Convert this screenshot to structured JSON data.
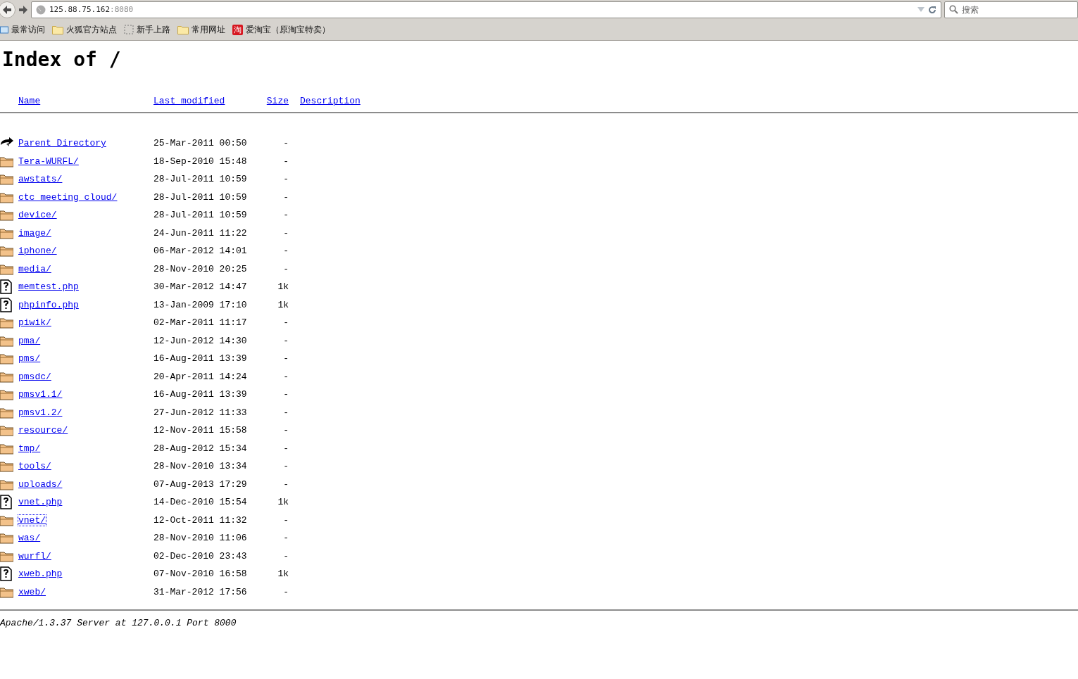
{
  "browser": {
    "url_host": "125.88.75.162",
    "url_port": ":8080",
    "search_placeholder": "搜索",
    "bookmarks": [
      {
        "kind": "frequent",
        "label": "最常访问"
      },
      {
        "kind": "folder",
        "label": "火狐官方站点"
      },
      {
        "kind": "blank",
        "label": "新手上路"
      },
      {
        "kind": "folder",
        "label": "常用网址"
      },
      {
        "kind": "badge",
        "badge_text": "淘",
        "label": "爱淘宝（原淘宝特卖）"
      }
    ]
  },
  "page": {
    "title": "Index of /",
    "columns": [
      "Name",
      "Last modified",
      "Size",
      "Description"
    ],
    "rows": [
      {
        "kind": "parent",
        "name": "Parent Directory",
        "modified": "25-Mar-2011 00:50",
        "size": "-",
        "focused": false
      },
      {
        "kind": "folder",
        "name": "Tera-WURFL/",
        "modified": "18-Sep-2010 15:48",
        "size": "-",
        "focused": false
      },
      {
        "kind": "folder",
        "name": "awstats/",
        "modified": "28-Jul-2011 10:59",
        "size": "-",
        "focused": false
      },
      {
        "kind": "folder",
        "name": "ctc_meeting_cloud/",
        "modified": "28-Jul-2011 10:59",
        "size": "-",
        "focused": false
      },
      {
        "kind": "folder",
        "name": "device/",
        "modified": "28-Jul-2011 10:59",
        "size": "-",
        "focused": false
      },
      {
        "kind": "folder",
        "name": "image/",
        "modified": "24-Jun-2011 11:22",
        "size": "-",
        "focused": false
      },
      {
        "kind": "folder",
        "name": "iphone/",
        "modified": "06-Mar-2012 14:01",
        "size": "-",
        "focused": false
      },
      {
        "kind": "folder",
        "name": "media/",
        "modified": "28-Nov-2010 20:25",
        "size": "-",
        "focused": false
      },
      {
        "kind": "file",
        "name": "memtest.php",
        "modified": "30-Mar-2012 14:47",
        "size": "1k",
        "focused": false
      },
      {
        "kind": "file",
        "name": "phpinfo.php",
        "modified": "13-Jan-2009 17:10",
        "size": "1k",
        "focused": false
      },
      {
        "kind": "folder",
        "name": "piwik/",
        "modified": "02-Mar-2011 11:17",
        "size": "-",
        "focused": false
      },
      {
        "kind": "folder",
        "name": "pma/",
        "modified": "12-Jun-2012 14:30",
        "size": "-",
        "focused": false
      },
      {
        "kind": "folder",
        "name": "pms/",
        "modified": "16-Aug-2011 13:39",
        "size": "-",
        "focused": false
      },
      {
        "kind": "folder",
        "name": "pmsdc/",
        "modified": "20-Apr-2011 14:24",
        "size": "-",
        "focused": false
      },
      {
        "kind": "folder",
        "name": "pmsv1.1/",
        "modified": "16-Aug-2011 13:39",
        "size": "-",
        "focused": false
      },
      {
        "kind": "folder",
        "name": "pmsv1.2/",
        "modified": "27-Jun-2012 11:33",
        "size": "-",
        "focused": false
      },
      {
        "kind": "folder",
        "name": "resource/",
        "modified": "12-Nov-2011 15:58",
        "size": "-",
        "focused": false
      },
      {
        "kind": "folder",
        "name": "tmp/",
        "modified": "28-Aug-2012 15:34",
        "size": "-",
        "focused": false
      },
      {
        "kind": "folder",
        "name": "tools/",
        "modified": "28-Nov-2010 13:34",
        "size": "-",
        "focused": false
      },
      {
        "kind": "folder",
        "name": "uploads/",
        "modified": "07-Aug-2013 17:29",
        "size": "-",
        "focused": false
      },
      {
        "kind": "file",
        "name": "vnet.php",
        "modified": "14-Dec-2010 15:54",
        "size": "1k",
        "focused": false
      },
      {
        "kind": "folder",
        "name": "vnet/",
        "modified": "12-Oct-2011 11:32",
        "size": "-",
        "focused": true
      },
      {
        "kind": "folder",
        "name": "was/",
        "modified": "28-Nov-2010 11:06",
        "size": "-",
        "focused": false
      },
      {
        "kind": "folder",
        "name": "wurfl/",
        "modified": "02-Dec-2010 23:43",
        "size": "-",
        "focused": false
      },
      {
        "kind": "file",
        "name": "xweb.php",
        "modified": "07-Nov-2010 16:58",
        "size": "1k",
        "focused": false
      },
      {
        "kind": "folder",
        "name": "xweb/",
        "modified": "31-Mar-2012 17:56",
        "size": "-",
        "focused": false
      }
    ],
    "address": "Apache/1.3.37 Server at 127.0.0.1 Port 8000"
  }
}
